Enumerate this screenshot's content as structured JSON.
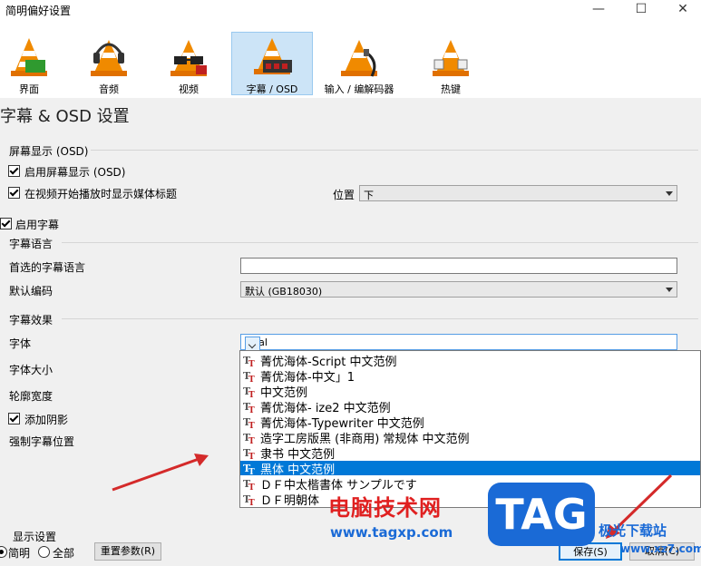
{
  "window": {
    "title": "简明偏好设置",
    "minimize": "—",
    "maximize": "☐",
    "close": "✕"
  },
  "toolbar": {
    "items": [
      {
        "label": "界面",
        "icon": "cone-interface-icon"
      },
      {
        "label": "音频",
        "icon": "cone-headphones-icon"
      },
      {
        "label": "视频",
        "icon": "cone-glasses-icon"
      },
      {
        "label": "字幕 / OSD",
        "icon": "cone-subtitle-icon",
        "selected": true
      },
      {
        "label": "输入 / 编解码器",
        "icon": "cone-cable-icon"
      },
      {
        "label": "热键",
        "icon": "cone-hotkeys-icon"
      }
    ]
  },
  "section_title": "字幕 & OSD 设置",
  "osd": {
    "group": "屏幕显示 (OSD)",
    "enable_osd": "启用屏幕显示 (OSD)",
    "show_title": "在视频开始播放时显示媒体标题",
    "position_label": "位置",
    "position_value": "下"
  },
  "subtitles": {
    "enable": "启用字幕",
    "language_group": "字幕语言",
    "preferred_lang_label": "首选的字幕语言",
    "preferred_lang_value": "",
    "encoding_label": "默认编码",
    "encoding_value": "默认 (GB18030)",
    "effects_group": "字幕效果",
    "font_label": "字体",
    "font_value": "Arial",
    "font_size_label": "字体大小",
    "outline_label": "轮廓宽度",
    "shadow_label": "添加阴影",
    "force_pos_label": "强制字幕位置"
  },
  "font_list": [
    "菁优海体-Script  中文范例",
    "菁优海体-中文」1",
    "                中文范例",
    "菁优海体- ize2  中文范例",
    "菁优海体-Typewriter  中文范例",
    "造字工房版黑 (非商用) 常规体  中文范例",
    "隶书   中文范例",
    "黑体   中文范例",
    "ＤＦ中太楷書体  サンプルです",
    "ＤＦ明朝体"
  ],
  "bottom": {
    "display_group": "显示设置",
    "simple": "简明",
    "all": "全部",
    "reset": "重置参数(R)",
    "save": "保存(S)",
    "cancel": "取消(C)"
  },
  "watermark": {
    "site_cn": "电脑技术网",
    "url": "www.tagxp.com",
    "tag": "TAG",
    "side": "极光下载站",
    "side_url": "www.xz7.com"
  },
  "colors": {
    "selection": "#0078d7",
    "arrow": "#d42a2a",
    "watermark_blue": "#1a6ad6",
    "watermark_red": "#e02020"
  }
}
